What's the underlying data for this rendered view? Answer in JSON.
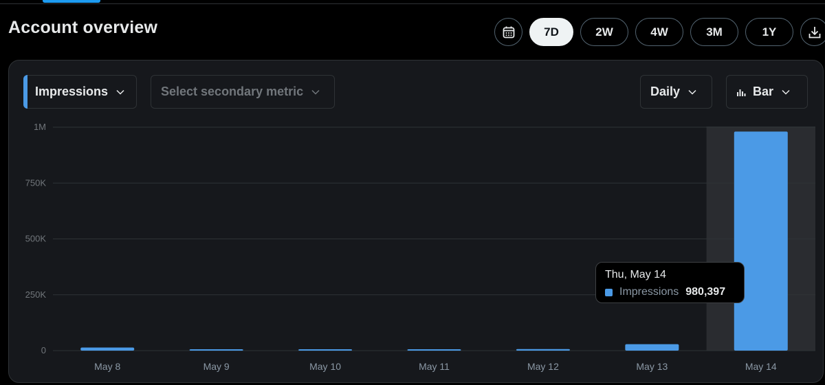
{
  "header": {
    "title": "Account overview"
  },
  "range": {
    "options": [
      "7D",
      "2W",
      "4W",
      "3M",
      "1Y"
    ],
    "selected": "7D",
    "calendar_icon": "calendar-icon",
    "download_icon": "download-icon"
  },
  "controls": {
    "primary_metric": "Impressions",
    "secondary_metric_placeholder": "Select secondary metric",
    "period": "Daily",
    "chart_type": "Bar",
    "chart_type_icon": "bar-chart-icon"
  },
  "colors": {
    "accent": "#4b9ae6",
    "selected_pill": "#eff3f4",
    "highlight_column": "#2a2c30"
  },
  "chart_data": {
    "type": "bar",
    "categories": [
      "May 8",
      "May 9",
      "May 10",
      "May 11",
      "May 12",
      "May 13",
      "May 14"
    ],
    "series": [
      {
        "name": "Impressions",
        "values": [
          14000,
          4000,
          2000,
          4000,
          7000,
          29000,
          980397
        ]
      }
    ],
    "ylim": [
      0,
      1000000
    ],
    "yticks": [
      0,
      250000,
      500000,
      750000,
      1000000
    ],
    "ytick_labels": [
      "0",
      "250K",
      "500K",
      "750K",
      "1M"
    ],
    "grid": true,
    "highlighted_index": 6
  },
  "tooltip": {
    "date": "Thu, May 14",
    "metric": "Impressions",
    "value": "980,397"
  }
}
